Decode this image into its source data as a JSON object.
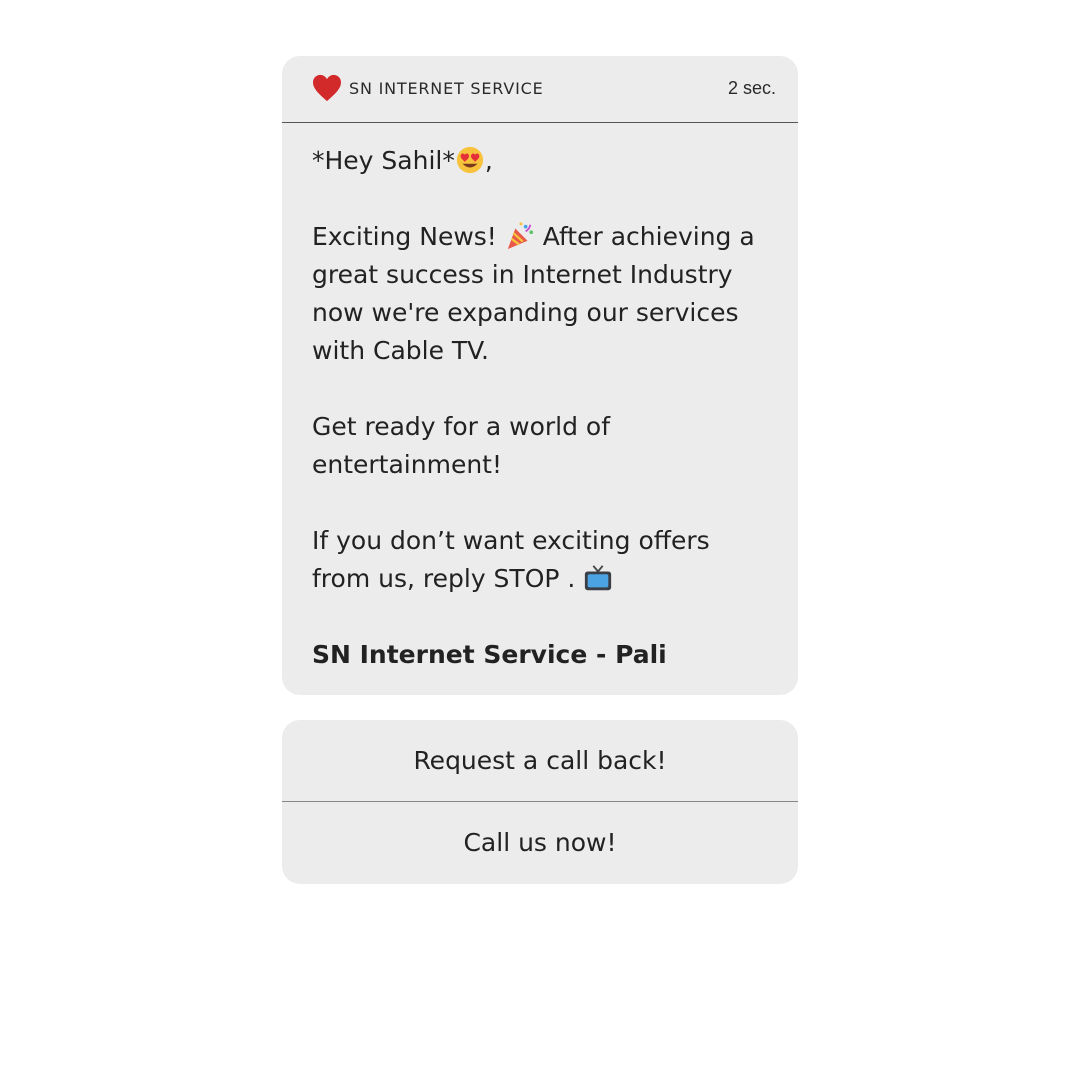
{
  "notification": {
    "app_icon": "heart-icon",
    "sender": "SN INTERNET SERVICE",
    "time": "2 sec.",
    "accent_color": "#d22a2a"
  },
  "message": {
    "greeting": "*Hey Sahil*",
    "greeting_emoji": "heart-eyes-emoji",
    "greeting_suffix": ",",
    "news_prefix": "Exciting News!",
    "news_emoji": "party-popper-emoji",
    "news_line1_suffix": "After achieving a",
    "news_line2": "great success in Internet Industry",
    "news_line3": "now we're expanding our services",
    "news_line4": "with Cable TV.",
    "ready_line1": "Get ready for a world of",
    "ready_line2": "entertainment!",
    "optout_line1": "If you don’t want exciting offers",
    "optout_line2": "from us, reply STOP .",
    "optout_emoji": "television-emoji",
    "signature": "SN Internet Service - Pali"
  },
  "actions": [
    {
      "label": "Request a call back!"
    },
    {
      "label": "Call us now!"
    }
  ]
}
